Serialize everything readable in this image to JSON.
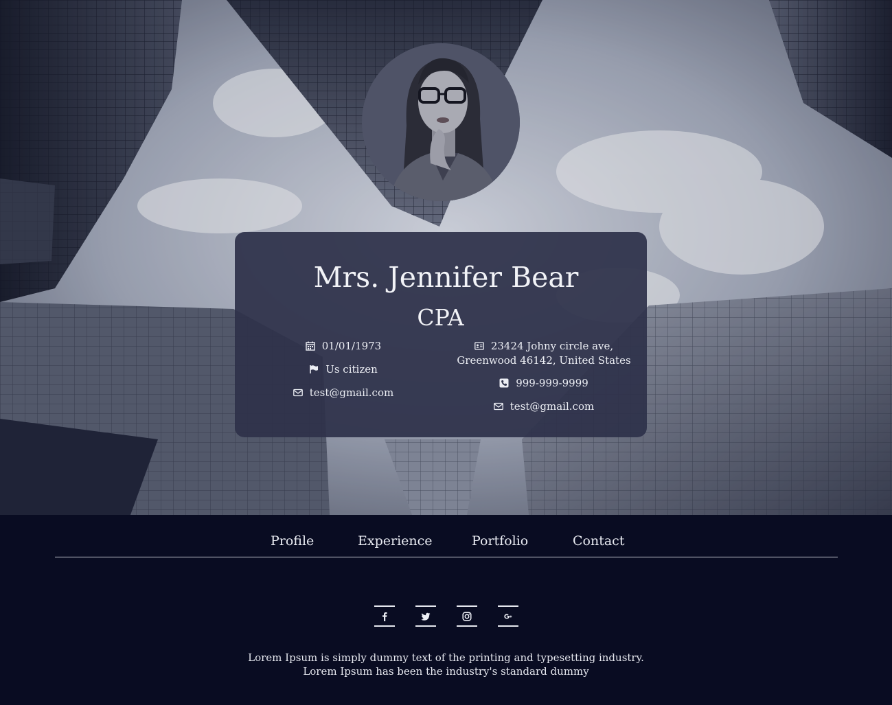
{
  "profile": {
    "name": "Mrs. Jennifer Bear",
    "title": "CPA",
    "left_info": {
      "dob": "01/01/1973",
      "citizenship": "Us citizen",
      "email": "test@gmail.com"
    },
    "right_info": {
      "address_line1": "23424 Johny circle ave,",
      "address_line2": "Greenwood 46142, United States",
      "phone": "999-999-9999",
      "email": "test@gmail.com"
    }
  },
  "icons": {
    "dob": "calendar-icon",
    "citizenship": "flag-icon",
    "email": "envelope-icon",
    "address": "id-card-icon",
    "phone": "phone-icon"
  },
  "nav": {
    "items": [
      "Profile",
      "Experience",
      "Portfolio",
      "Contact"
    ]
  },
  "social": [
    "facebook-icon",
    "twitter-icon",
    "instagram-icon",
    "google-plus-icon"
  ],
  "footer": {
    "line1": "Lorem Ipsum is simply dummy text of the printing and typesetting industry.",
    "line2": "Lorem Ipsum has been the industry's standard dummy"
  },
  "colors": {
    "background": "#090c22",
    "card": "#2e324a",
    "text": "#eef0f6"
  }
}
